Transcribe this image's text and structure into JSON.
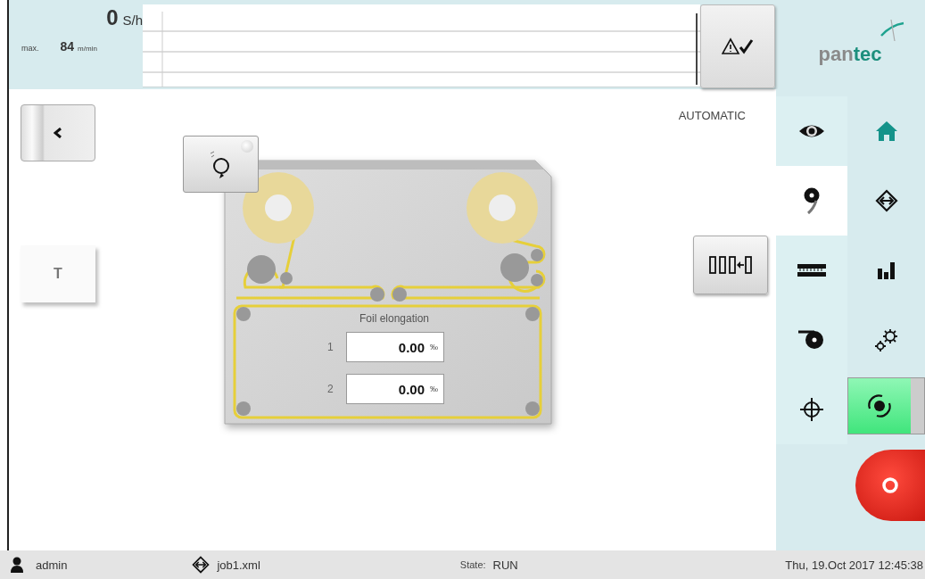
{
  "speed": {
    "value": "0",
    "unit": "S/h",
    "max_label": "max.",
    "max_value": "84",
    "max_unit": "m/min"
  },
  "logo": {
    "part_1": "pan",
    "part_2": "tec"
  },
  "mode": "AUTOMATIC",
  "left_buttons": [
    {
      "kind": "back"
    },
    {
      "kind": "text",
      "label": "T"
    }
  ],
  "diagram": {
    "title": "Foil elongation",
    "readings": [
      {
        "label": "1",
        "value": "0.00",
        "unit": "‰"
      },
      {
        "label": "2",
        "value": "0.00",
        "unit": "‰"
      }
    ]
  },
  "tabs": [
    {
      "kind": "eye",
      "selected": false
    },
    {
      "kind": "reel",
      "selected": true
    },
    {
      "kind": "ruler",
      "selected": false
    },
    {
      "kind": "roll",
      "selected": false
    },
    {
      "kind": "target",
      "selected": false
    }
  ],
  "nav": [
    {
      "kind": "home",
      "selected": true
    },
    {
      "kind": "transfer",
      "selected": false
    },
    {
      "kind": "stats",
      "selected": false
    },
    {
      "kind": "settings",
      "selected": false
    },
    {
      "kind": "toggle",
      "on": true
    },
    {
      "kind": "stop"
    }
  ],
  "status_bar": {
    "user": "admin",
    "job": "job1.xml",
    "state_label": "State:",
    "state": "RUN",
    "datetime": "Thu, 19.Oct 2017 12:45:38"
  }
}
